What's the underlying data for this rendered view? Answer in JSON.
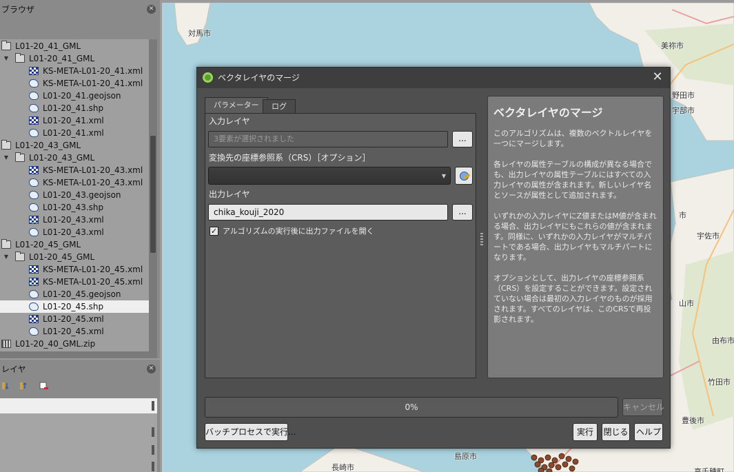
{
  "browser_panel": {
    "title": "ブラウザ",
    "items": [
      {
        "label": "L01-20_41_GML",
        "type": "folder",
        "level": 0
      },
      {
        "label": "L01-20_41_GML",
        "type": "folder",
        "level": 1,
        "expanded": true
      },
      {
        "label": "KS-META-L01-20_41.xml",
        "type": "xml",
        "level": 2
      },
      {
        "label": "KS-META-L01-20_41.xml",
        "type": "vector",
        "level": 2
      },
      {
        "label": "L01-20_41.geojson",
        "type": "vector",
        "level": 2
      },
      {
        "label": "L01-20_41.shp",
        "type": "vector",
        "level": 2
      },
      {
        "label": "L01-20_41.xml",
        "type": "xml",
        "level": 2
      },
      {
        "label": "L01-20_41.xml",
        "type": "vector",
        "level": 2
      },
      {
        "label": "L01-20_43_GML",
        "type": "folder",
        "level": 0
      },
      {
        "label": "L01-20_43_GML",
        "type": "folder",
        "level": 1,
        "expanded": true
      },
      {
        "label": "KS-META-L01-20_43.xml",
        "type": "xml",
        "level": 2
      },
      {
        "label": "KS-META-L01-20_43.xml",
        "type": "vector",
        "level": 2
      },
      {
        "label": "L01-20_43.geojson",
        "type": "vector",
        "level": 2
      },
      {
        "label": "L01-20_43.shp",
        "type": "vector",
        "level": 2
      },
      {
        "label": "L01-20_43.xml",
        "type": "xml",
        "level": 2
      },
      {
        "label": "L01-20_43.xml",
        "type": "vector",
        "level": 2
      },
      {
        "label": "L01-20_45_GML",
        "type": "folder",
        "level": 0
      },
      {
        "label": "L01-20_45_GML",
        "type": "folder",
        "level": 1,
        "expanded": true
      },
      {
        "label": "KS-META-L01-20_45.xml",
        "type": "xml",
        "level": 2
      },
      {
        "label": "KS-META-L01-20_45.xml",
        "type": "xml",
        "level": 2
      },
      {
        "label": "L01-20_45.geojson",
        "type": "vector",
        "level": 2
      },
      {
        "label": "L01-20_45.shp",
        "type": "vector",
        "level": 2,
        "selected": true
      },
      {
        "label": "L01-20_45.xml",
        "type": "xml",
        "level": 2
      },
      {
        "label": "L01-20_45.xml",
        "type": "vector",
        "level": 2
      },
      {
        "label": "L01-20_40_GML.zip",
        "type": "zip",
        "level": 0
      }
    ]
  },
  "layers_panel": {
    "title": "レイヤ"
  },
  "map": {
    "labels": [
      "対馬市",
      "美祢市",
      "野田市",
      "宇部市",
      "宇佐市",
      "由布市",
      "竹田市",
      "長崎市",
      "島原市",
      "豊後市",
      "高千穂町",
      "山市",
      "市"
    ]
  },
  "dialog": {
    "title": "ベクタレイヤのマージ",
    "tabs": [
      "パラメーター",
      "ログ"
    ],
    "input_layer_label": "入力レイヤ",
    "input_layer_value": "3要素が選択されました",
    "crs_label": "変換先の座標参照系（CRS）［オプション］",
    "crs_value": "",
    "output_layer_label": "出力レイヤ",
    "output_layer_value": "chika_kouji_2020",
    "open_output_label": "アルゴリズムの実行後に出力ファイルを開く",
    "open_output_checked": "✓",
    "dots": "...",
    "help": {
      "title": "ベクタレイヤのマージ",
      "paragraphs": [
        "このアルゴリズムは、複数のベクトルレイヤを一つにマージします。",
        "各レイヤの属性テーブルの構成が異なる場合でも、出力レイヤの属性テーブルにはすべての入力レイヤの属性が含まれます。新しいレイヤ名とソースが属性として追加されます。",
        "いずれかの入力レイヤにZ値またはM値が含まれる場合、出力レイヤにもこれらの値が含まれます。同様に、いずれかの入力レイヤがマルチパートである場合、出力レイヤもマルチパートになります。",
        "オプションとして、出力レイヤの座標参照系（CRS）を設定することができます。設定されていない場合は最初の入力レイヤのものが採用されます。すべてのレイヤは、このCRSで再投影されます。"
      ]
    },
    "progress_text": "0%",
    "progress_fraction": 0,
    "cancel_label": "キャンセル",
    "batch_label": "バッチプロセスで実行...",
    "run_label": "実行",
    "close_label": "閉じる",
    "help_label": "ヘルプ"
  }
}
